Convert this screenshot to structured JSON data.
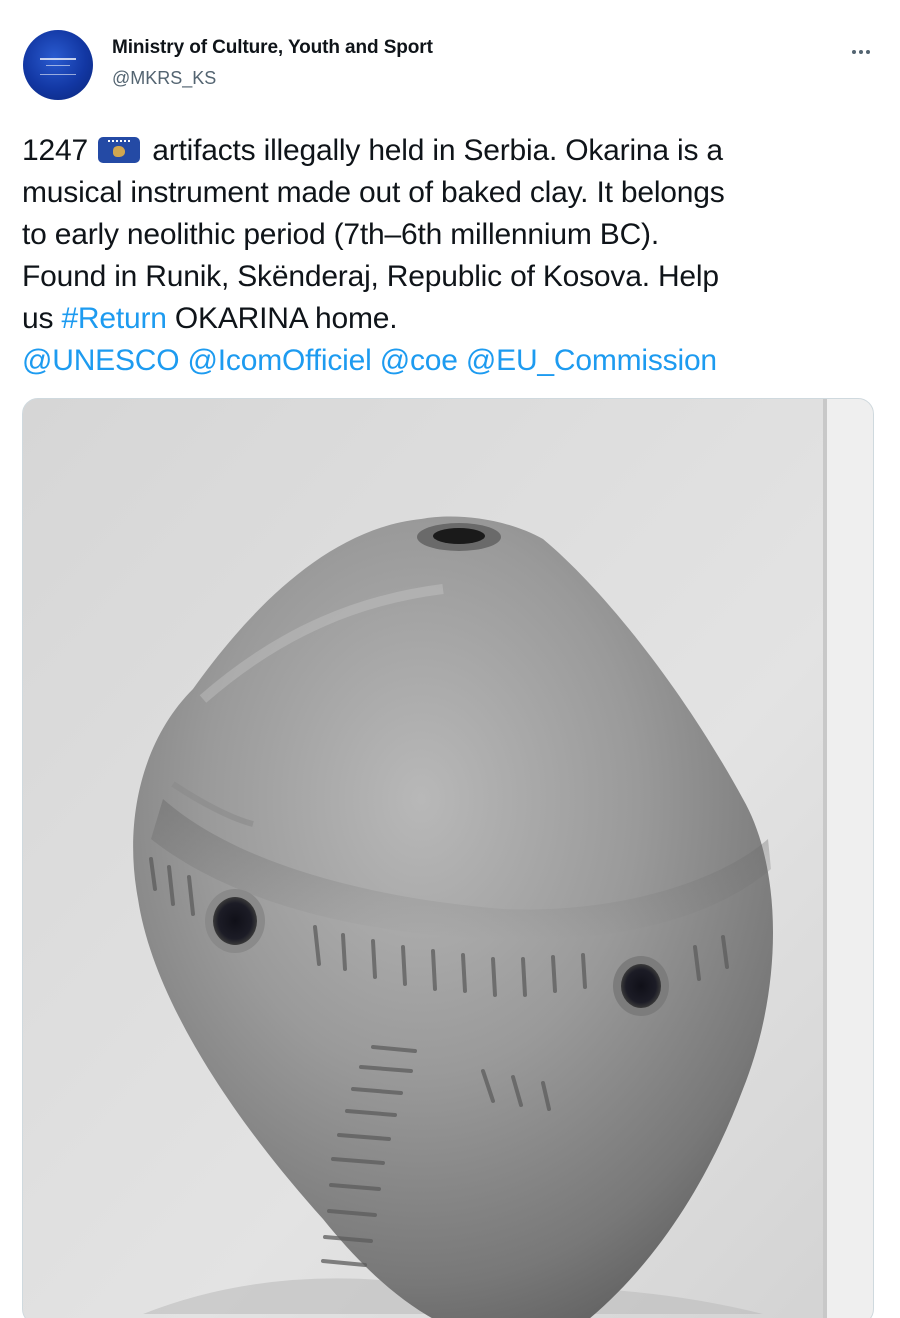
{
  "author": {
    "display_name": "Ministry of Culture, Youth and Sport",
    "handle": "@MKRS_KS",
    "avatar_icon": "ministry-logo-icon"
  },
  "more_icon": "more-options-icon",
  "tweet": {
    "line1": {
      "number": "1247",
      "flag_icon": "kosovo-flag-icon",
      "rest": "artifacts illegally held in Serbia. Okarina is a"
    },
    "line2": "musical instrument made out of baked clay. It belongs",
    "line3": "to early neolithic period (7th–6th millennium BC).",
    "line4": "Found in Runik, Skënderaj, Republic of Kosova. Help",
    "line5": {
      "before": "us",
      "hashtag": "#Return",
      "after": "OKARINA home."
    },
    "mentions": [
      "@UNESCO",
      "@IcomOfficiel",
      "@coe",
      "@EU_Commission"
    ]
  },
  "colors": {
    "link": "#1d9bf0",
    "text": "#0f1419",
    "secondary": "#536471",
    "avatar_bg": "#1237a3"
  }
}
